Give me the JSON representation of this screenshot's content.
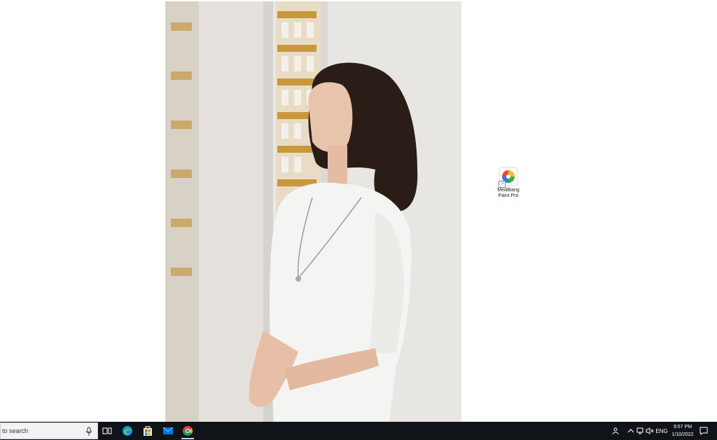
{
  "desktop": {
    "wallpaper": "photo-woman-in-white-dress",
    "icons": [
      {
        "label": "MediBang\nPaint Pro",
        "icon": "medibang-app-icon"
      }
    ]
  },
  "taskbar": {
    "search": {
      "placeholder": "to search",
      "icon": "microphone-icon"
    },
    "pinned": [
      {
        "name": "task-view",
        "icon": "task-view-icon"
      },
      {
        "name": "edge",
        "icon": "edge-icon"
      },
      {
        "name": "store",
        "icon": "store-icon"
      },
      {
        "name": "mail",
        "icon": "mail-icon"
      },
      {
        "name": "chrome",
        "icon": "chrome-icon",
        "active": true
      }
    ],
    "tray": {
      "language": "ENG",
      "time": "9:57 PM",
      "date": "1/10/2022"
    }
  }
}
